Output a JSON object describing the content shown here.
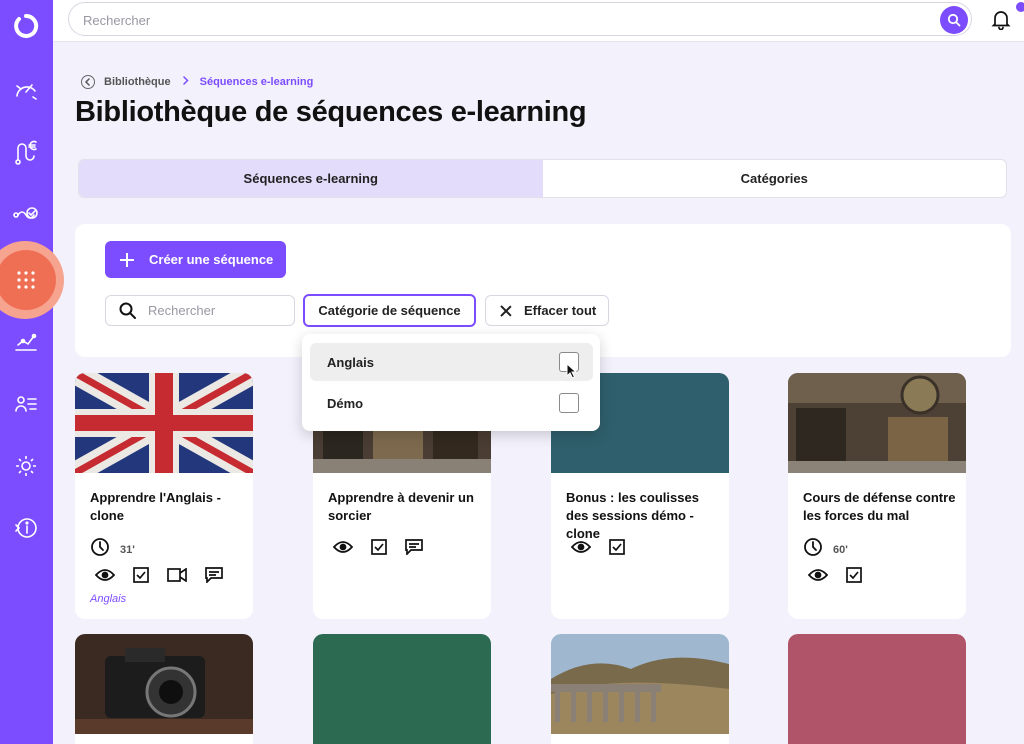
{
  "topbar": {
    "search_placeholder": "Rechercher"
  },
  "sidebar": {
    "items": [
      {
        "icon": "speed-icon"
      },
      {
        "icon": "euro-route-icon"
      },
      {
        "icon": "path-check-icon"
      },
      {
        "icon": "grid-dots-icon",
        "active": true
      },
      {
        "icon": "chart-line-icon"
      },
      {
        "icon": "list-users-icon"
      },
      {
        "icon": "gear-icon"
      },
      {
        "icon": "info-circle-icon"
      }
    ]
  },
  "breadcrumb": {
    "parent": "Bibliothèque",
    "current": "Séquences e-learning"
  },
  "page_title": "Bibliothèque de séquences e-learning",
  "tabs": [
    {
      "label": "Séquences e-learning",
      "active": true
    },
    {
      "label": "Catégories",
      "active": false
    }
  ],
  "filters": {
    "create_label": "Créer une séquence",
    "search_placeholder": "Rechercher",
    "category_label": "Catégorie de séquence",
    "clear_label": "Effacer tout"
  },
  "dropdown": {
    "options": [
      {
        "label": "Anglais",
        "checked": false,
        "hovered": true
      },
      {
        "label": "Démo",
        "checked": false
      }
    ]
  },
  "cards": [
    {
      "title": "Apprendre l'Anglais - clone",
      "duration": "31'",
      "tag": "Anglais"
    },
    {
      "title": "Apprendre à devenir un sorcier",
      "duration": "",
      "tag": ""
    },
    {
      "title": "Bonus : les coulisses des sessions démo - clone",
      "duration": "",
      "tag": ""
    },
    {
      "title": "Cours de défense contre les forces du mal",
      "duration": "60'",
      "tag": ""
    }
  ],
  "colors": {
    "accent": "#7c4dff",
    "sidebar_active": "#ef6f55",
    "tab_active_bg": "#e4dcfb",
    "card3_bg": "#2f5f6c",
    "card_row2_green": "#2c6a52",
    "card_row2_rose": "#b05469"
  }
}
